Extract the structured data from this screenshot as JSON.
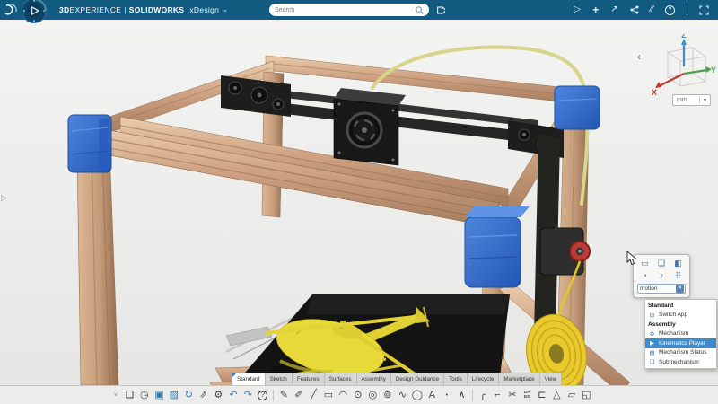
{
  "topbar": {
    "brand_bold": "3D",
    "brand_rest": "EXPERIENCE",
    "divider": "|",
    "product": "SOLIDWORKS",
    "app_name": "xDesign",
    "app_caret": "⌄",
    "search_placeholder": "Search",
    "icons": [
      {
        "name": "play-media-icon",
        "glyph": "▷"
      },
      {
        "name": "add-icon",
        "glyph": "+",
        "cls": "plus"
      },
      {
        "name": "export-arrow-icon",
        "glyph": "↗"
      },
      {
        "name": "share-icon",
        "glyph": "share-svg"
      },
      {
        "name": "collaboration-icon",
        "glyph": "∕∕"
      },
      {
        "name": "help-icon",
        "glyph": "?"
      },
      {
        "name": "fullscreen-icon",
        "glyph": "fullscreen-svg"
      }
    ]
  },
  "viewport": {
    "left_flyout_glyph": "▷",
    "back_chevron": "‹",
    "triad": {
      "x_label": "X",
      "y_label": "Y",
      "z_label": "Z",
      "x_color": "#c0392b",
      "y_color": "#4ea24e",
      "z_color": "#3b8fd4"
    },
    "units_value": "mm",
    "units_caret": "▾"
  },
  "context_popup": {
    "tools": [
      {
        "name": "insert-tool-icon",
        "glyph": "▭"
      },
      {
        "name": "duplicate-tool-icon",
        "glyph": "❏"
      },
      {
        "name": "component-tool-icon",
        "glyph": "◧"
      },
      {
        "name": "measure-tool-icon",
        "glyph": "◔"
      },
      {
        "name": "annotation-tool-icon",
        "glyph": "♪"
      },
      {
        "name": "pattern-tool-icon",
        "glyph": "⠿"
      }
    ],
    "search_value": "motion",
    "clear_glyph": "✕"
  },
  "context_menu": {
    "rows": [
      {
        "name": "menu-header-standard",
        "label": "Standard",
        "cls": "header"
      },
      {
        "name": "menu-item-switch-app",
        "label": "Switch App",
        "glyph": "⊞"
      },
      {
        "name": "menu-header-assembly",
        "label": "Assembly",
        "cls": "header"
      },
      {
        "name": "menu-item-mechanism",
        "label": "Mechanism",
        "glyph": "⚙"
      },
      {
        "name": "menu-item-kinematics-player",
        "label": "Kinematics Player",
        "glyph": "▶",
        "cls": "selected"
      },
      {
        "name": "menu-item-mechanism-status",
        "label": "Mechanism Status",
        "glyph": "▤"
      },
      {
        "name": "menu-item-submechanism",
        "label": "Submechanism",
        "glyph": "❏"
      }
    ]
  },
  "tabs": [
    {
      "name": "tab-standard",
      "label": "Standard",
      "cls": "active"
    },
    {
      "name": "tab-sketch",
      "label": "Sketch"
    },
    {
      "name": "tab-features",
      "label": "Features"
    },
    {
      "name": "tab-surfaces",
      "label": "Surfaces"
    },
    {
      "name": "tab-assembly",
      "label": "Assembly"
    },
    {
      "name": "tab-design-guidance",
      "label": "Design Guidance"
    },
    {
      "name": "tab-tools",
      "label": "Tools"
    },
    {
      "name": "tab-lifecycle",
      "label": "Lifecycle"
    },
    {
      "name": "tab-marketplace",
      "label": "Marketplace"
    },
    {
      "name": "tab-view",
      "label": "View"
    }
  ],
  "toolbar": {
    "collapse_glyph": "˅",
    "icons": [
      {
        "name": "insert-component-icon",
        "glyph": "❏"
      },
      {
        "name": "history-icon",
        "glyph": "◷"
      },
      {
        "name": "save-icon",
        "glyph": "▣",
        "cls": "blue"
      },
      {
        "name": "save-as-icon",
        "glyph": "▨",
        "cls": "blue"
      },
      {
        "name": "sync-icon",
        "glyph": "↻",
        "cls": "blue"
      },
      {
        "name": "publish-icon",
        "glyph": "⇗"
      },
      {
        "name": "settings-gear-icon",
        "glyph": "⚙"
      },
      {
        "name": "undo-icon",
        "glyph": "↶",
        "cls": "blue"
      },
      {
        "name": "redo-icon",
        "glyph": "↷",
        "cls": "blue"
      },
      {
        "name": "help-circle-icon",
        "glyph": "?",
        "cls": "help"
      },
      {
        "name": "separator",
        "cls": "sep"
      },
      {
        "name": "sketch-icon",
        "glyph": "✎"
      },
      {
        "name": "project-entities-icon",
        "glyph": "✐"
      },
      {
        "name": "line-icon",
        "glyph": "╱"
      },
      {
        "name": "rectangle-icon",
        "glyph": "▭"
      },
      {
        "name": "arc-icon",
        "glyph": "◠"
      },
      {
        "name": "circle-icon",
        "glyph": "⊙"
      },
      {
        "name": "circle-perimeter-icon",
        "glyph": "◎"
      },
      {
        "name": "circle-3point-icon",
        "glyph": "⊚"
      },
      {
        "name": "spline-icon",
        "glyph": "∿"
      },
      {
        "name": "ellipse-icon",
        "glyph": "◯"
      },
      {
        "name": "text-icon",
        "glyph": "A"
      },
      {
        "name": "point-icon",
        "glyph": "•",
        "cls": "small"
      },
      {
        "name": "polyline-icon",
        "glyph": "∧"
      },
      {
        "name": "separator",
        "cls": "sep"
      },
      {
        "name": "fillet-icon",
        "glyph": "╭"
      },
      {
        "name": "chamfer-icon",
        "glyph": "⌐"
      },
      {
        "name": "trim-icon",
        "glyph": "✂"
      },
      {
        "name": "mirror-pattern-icon",
        "glyph": "DP\nDD",
        "cls": "tiny"
      },
      {
        "name": "offset-icon",
        "glyph": "⊏"
      },
      {
        "name": "polygon-icon",
        "glyph": "△"
      },
      {
        "name": "convert-3d-icon",
        "glyph": "▱"
      },
      {
        "name": "sketch-block-icon",
        "glyph": "◱"
      }
    ]
  },
  "colors": {
    "topbar_bg": "#115a80",
    "menu_highlight": "#3f8ccc",
    "frame_tan": "#cda181",
    "bracket_blue": "#3568c8",
    "model_yellow": "#e8d93a",
    "bed_black": "#141414",
    "motor_red": "#bf3a34"
  }
}
